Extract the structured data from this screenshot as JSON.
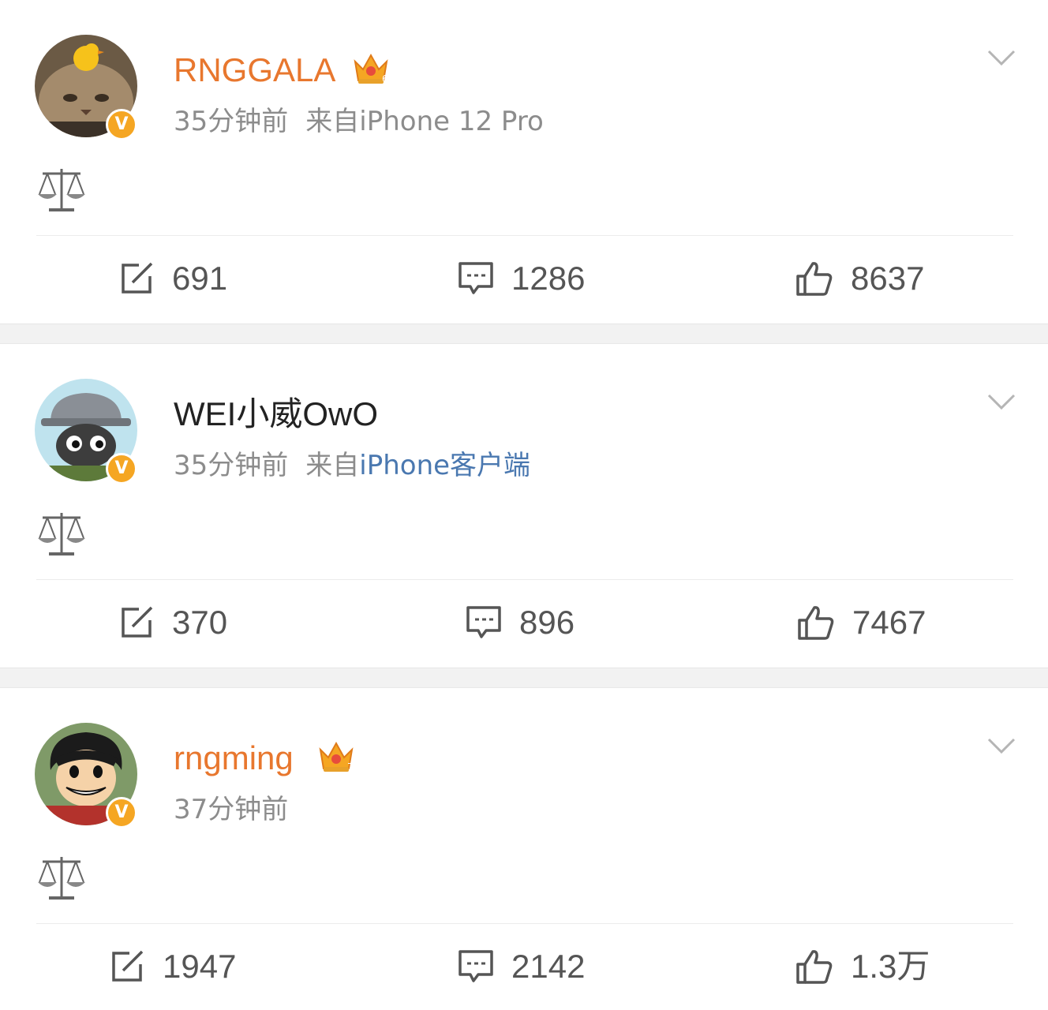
{
  "posts": [
    {
      "username": "RNGGALA",
      "vip": true,
      "crown_level": "6",
      "time": "35分钟前",
      "source_prefix": "来自",
      "source_device": "iPhone 12 Pro",
      "source_is_link": false,
      "content_icon": "balance-scale-icon",
      "reposts": "691",
      "comments": "1286",
      "likes": "8637"
    },
    {
      "username": "WEI小威OwO",
      "vip": false,
      "time": "35分钟前",
      "source_prefix": "来自",
      "source_device": "iPhone客户端",
      "source_is_link": true,
      "content_icon": "balance-scale-icon",
      "reposts": "370",
      "comments": "896",
      "likes": "7467"
    },
    {
      "username": "rngming",
      "vip": true,
      "crown_level": "7",
      "time": "37分钟前",
      "content_icon": "balance-scale-icon",
      "reposts": "1947",
      "comments": "2142",
      "likes": "1.3万"
    }
  ],
  "colors": {
    "vip_name": "#e8772e",
    "verified_badge": "#f5a623",
    "link": "#4a78b0",
    "meta": "#8c8c8c",
    "separator": "#f2f2f2"
  }
}
